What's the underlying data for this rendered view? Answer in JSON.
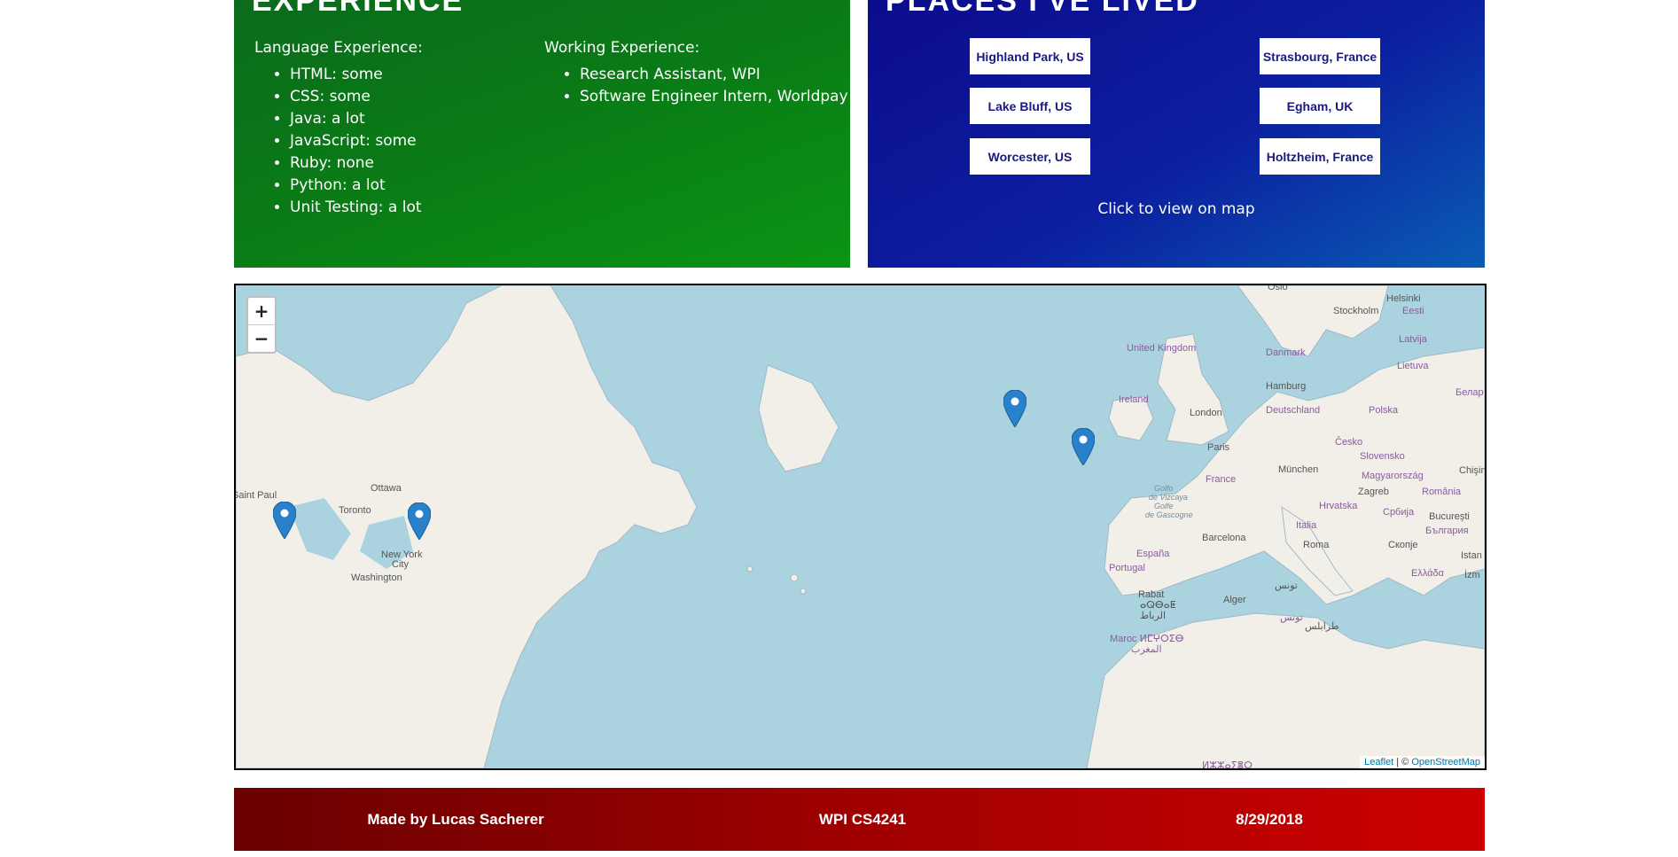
{
  "experience": {
    "heading": "EXPERIENCE",
    "language_title": "Language Experience:",
    "languages": [
      "HTML: some",
      "CSS: some",
      "Java: a lot",
      "JavaScript: some",
      "Ruby: none",
      "Python: a lot",
      "Unit Testing: a lot"
    ],
    "work_title": "Working Experience:",
    "work": [
      "Research Assistant, WPI",
      "Software Engineer Intern, Worldpay"
    ]
  },
  "places": {
    "heading": "PLACES I'VE LIVED",
    "buttons": [
      "Highland Park, US",
      "Strasbourg, France",
      "Lake Bluff, US",
      "Egham, UK",
      "Worcester, US",
      "Holtzheim, France"
    ],
    "hint": "Click to view on map"
  },
  "map": {
    "zoom_in": "+",
    "zoom_out": "−",
    "labels": {
      "oslo": "Oslo",
      "helsinki": "Helsinki",
      "stockholm": "Stockholm",
      "eesti": "Eesti",
      "latvija": "Latvija",
      "lietuva": "Lietuva",
      "belarus": "Белар",
      "united_kingdom": "United Kingdom",
      "danmark": "Danmark",
      "hamburg": "Hamburg",
      "ireland": "Ireland",
      "london": "London",
      "deutschland": "Deutschland",
      "polska": "Polska",
      "paris": "Paris",
      "cesko": "Česko",
      "slovensko": "Slovensko",
      "munchen": "München",
      "magyarorszag": "Magyarország",
      "chisin": "Chişin",
      "france": "France",
      "zagreb": "Zagreb",
      "romania": "România",
      "hrvatska": "Hrvatska",
      "srbija": "Србија",
      "bucuresti": "București",
      "balgariya": "България",
      "skopje": "Скопје",
      "italia": "Italia",
      "roma": "Roma",
      "istan": "Istan",
      "ellada": "Ελλάδα",
      "izm": "İzm",
      "barcelona": "Barcelona",
      "espana": "España",
      "portugal": "Portugal",
      "golfo": "Golfo",
      "de_vizcaya": "de Vizcaya",
      "golfe": "Golfe",
      "de_gascogne": "de Gascogne",
      "tunis": "تونس",
      "tunisia": "تونس",
      "alger": "Alger",
      "rabat": "Rabat",
      "rabat_tf": "ⴰⵕⴱⴰⵟ",
      "rabat_ar": "الرباط",
      "maroc": "Maroc ⵍⵎⵖⵔⵉⴱ",
      "maghrib": "المغرب",
      "tarabulus": "طرابلس",
      "ikjl": "ⵍⵣⵣⴰⵢⴻⵔ",
      "saint_paul": "Saint Paul",
      "ottawa": "Ottawa",
      "toronto": "Toronto",
      "new_york": "New York",
      "city": "City",
      "washington": "Washington"
    },
    "attribution_leaflet": "Leaflet",
    "attribution_sep": " | © ",
    "attribution_osm": "OpenStreetMap"
  },
  "footer": {
    "author": "Made by Lucas Sacherer",
    "course": "WPI CS4241",
    "date": "8/29/2018"
  },
  "colors": {
    "experience_bg": "#0a7a16",
    "places_bg": "#0b1fa0",
    "footer_bg": "#a00000",
    "sea": "#aad3df",
    "land": "#f2efe9",
    "marker": "#2a81cb"
  }
}
